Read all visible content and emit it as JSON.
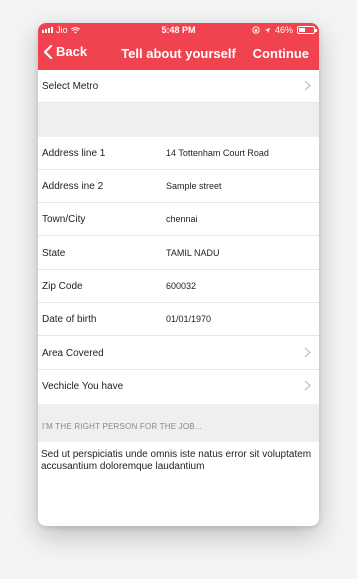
{
  "status_bar": {
    "carrier": "Jio",
    "time": "5:48 PM",
    "battery": "46%",
    "battery_level": 0.46
  },
  "nav": {
    "back_label": "Back",
    "title": "Tell about yourself",
    "continue_label": "Continue"
  },
  "form": {
    "select_metro": "Select Metro",
    "address_line1_label": "Address line 1",
    "address_line1_value": "14 Tottenham Court Road",
    "address_line2_label": "Address ine 2",
    "address_line2_value": "Sample street",
    "city_label": "Town/City",
    "city_value": "chennai",
    "state_label": "State",
    "state_value": "TAMIL NADU",
    "zip_label": "Zip Code",
    "zip_value": "600032",
    "dob_label": "Date of birth",
    "dob_value": "01/01/1970",
    "area_label": "Area Covered",
    "vehicle_label": "Vechicle You have"
  },
  "about": {
    "section_title": "I'M THE RIGHT PERSON FOR THE JOB...",
    "text": "Sed ut perspiciatis unde omnis iste natus error sit voluptatem accusantium doloremque laudantium"
  },
  "colors": {
    "accent": "#f0434f",
    "section_bg": "#efefef"
  }
}
